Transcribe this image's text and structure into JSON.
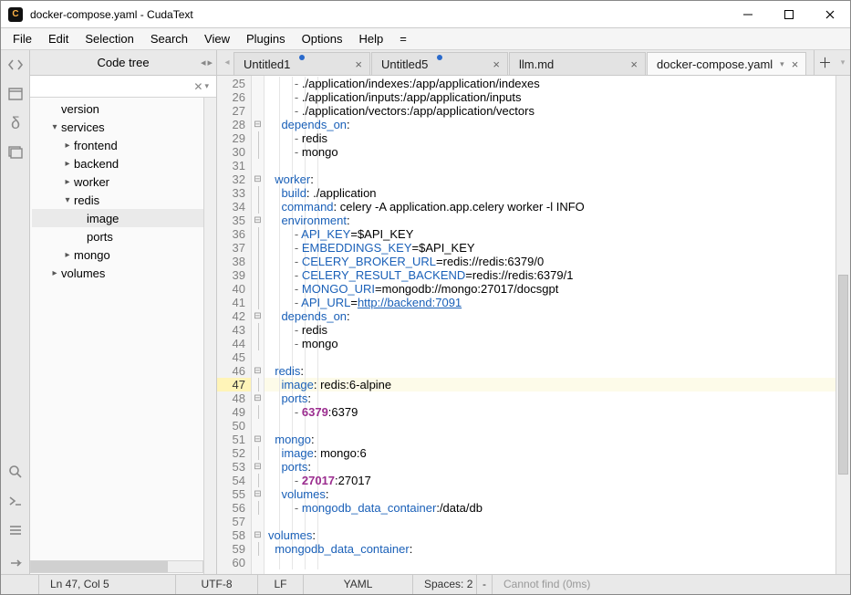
{
  "title": "docker-compose.yaml - CudaText",
  "menu": [
    "File",
    "Edit",
    "Selection",
    "Search",
    "View",
    "Plugins",
    "Options",
    "Help",
    "="
  ],
  "sidebar": {
    "title": "Code tree",
    "tree": [
      {
        "label": "version",
        "lvl": 1,
        "tw": ""
      },
      {
        "label": "services",
        "lvl": 1,
        "tw": "▾"
      },
      {
        "label": "frontend",
        "lvl": 2,
        "tw": "▸"
      },
      {
        "label": "backend",
        "lvl": 2,
        "tw": "▸"
      },
      {
        "label": "worker",
        "lvl": 2,
        "tw": "▸"
      },
      {
        "label": "redis",
        "lvl": 2,
        "tw": "▾"
      },
      {
        "label": "image",
        "lvl": 3,
        "tw": "",
        "selected": true
      },
      {
        "label": "ports",
        "lvl": 3,
        "tw": ""
      },
      {
        "label": "mongo",
        "lvl": 2,
        "tw": "▸"
      },
      {
        "label": "volumes",
        "lvl": 1,
        "tw": "▸"
      }
    ]
  },
  "tabs": [
    {
      "label": "Untitled1",
      "modified": true,
      "active": false
    },
    {
      "label": "Untitled5",
      "modified": true,
      "active": false
    },
    {
      "label": "llm.md",
      "modified": false,
      "active": false
    },
    {
      "label": "docker-compose.yaml",
      "modified": false,
      "active": true,
      "chev": true
    }
  ],
  "lines_start": 25,
  "current_line": 47,
  "code_lines": [
    {
      "n": 25,
      "fold": "",
      "html": "        <span class='tok-punct'>-</span> ./application/indexes:/app/application/indexes"
    },
    {
      "n": 26,
      "fold": "",
      "html": "        <span class='tok-punct'>-</span> ./application/inputs:/app/application/inputs"
    },
    {
      "n": 27,
      "fold": "",
      "html": "        <span class='tok-punct'>-</span> ./application/vectors:/app/application/vectors"
    },
    {
      "n": 28,
      "fold": "⊟",
      "html": "    <span class='tok-key'>depends_on</span>:"
    },
    {
      "n": 29,
      "fold": "│",
      "html": "        <span class='tok-punct'>-</span> redis"
    },
    {
      "n": 30,
      "fold": "│",
      "html": "        <span class='tok-punct'>-</span> mongo"
    },
    {
      "n": 31,
      "fold": "",
      "html": ""
    },
    {
      "n": 32,
      "fold": "⊟",
      "html": "  <span class='tok-key'>worker</span>:"
    },
    {
      "n": 33,
      "fold": "│",
      "html": "    <span class='tok-key'>build</span>: ./application"
    },
    {
      "n": 34,
      "fold": "│",
      "html": "    <span class='tok-key'>command</span>: celery -A application.app.celery worker -l INFO"
    },
    {
      "n": 35,
      "fold": "⊟",
      "html": "    <span class='tok-key'>environment</span>:"
    },
    {
      "n": 36,
      "fold": "│",
      "html": "        <span class='tok-punct'>-</span> <span class='tok-key'>API_KEY</span>=$API_KEY"
    },
    {
      "n": 37,
      "fold": "│",
      "html": "        <span class='tok-punct'>-</span> <span class='tok-key'>EMBEDDINGS_KEY</span>=$API_KEY"
    },
    {
      "n": 38,
      "fold": "│",
      "html": "        <span class='tok-punct'>-</span> <span class='tok-key'>CELERY_BROKER_URL</span>=redis://redis:6379/0"
    },
    {
      "n": 39,
      "fold": "│",
      "html": "        <span class='tok-punct'>-</span> <span class='tok-key'>CELERY_RESULT_BACKEND</span>=redis://redis:6379/1"
    },
    {
      "n": 40,
      "fold": "│",
      "html": "        <span class='tok-punct'>-</span> <span class='tok-key'>MONGO_URI</span>=mongodb://mongo:27017/docsgpt"
    },
    {
      "n": 41,
      "fold": "│",
      "html": "        <span class='tok-punct'>-</span> <span class='tok-key'>API_URL</span>=<span class='tok-link'>http://backend:7091</span>"
    },
    {
      "n": 42,
      "fold": "⊟",
      "html": "    <span class='tok-key'>depends_on</span>:"
    },
    {
      "n": 43,
      "fold": "│",
      "html": "        <span class='tok-punct'>-</span> redis"
    },
    {
      "n": 44,
      "fold": "│",
      "html": "        <span class='tok-punct'>-</span> mongo"
    },
    {
      "n": 45,
      "fold": "",
      "html": ""
    },
    {
      "n": 46,
      "fold": "⊟",
      "html": "  <span class='tok-key'>redis</span>:"
    },
    {
      "n": 47,
      "fold": "│",
      "html": "    <span class='tok-key'>image</span>: redis:6-alpine",
      "current": true
    },
    {
      "n": 48,
      "fold": "⊟",
      "html": "    <span class='tok-key'>ports</span>:"
    },
    {
      "n": 49,
      "fold": "│",
      "html": "        <span class='tok-punct'>-</span> <span class='tok-num'>6379</span>:6379"
    },
    {
      "n": 50,
      "fold": "",
      "html": ""
    },
    {
      "n": 51,
      "fold": "⊟",
      "html": "  <span class='tok-key'>mongo</span>:"
    },
    {
      "n": 52,
      "fold": "│",
      "html": "    <span class='tok-key'>image</span>: mongo:6"
    },
    {
      "n": 53,
      "fold": "⊟",
      "html": "    <span class='tok-key'>ports</span>:"
    },
    {
      "n": 54,
      "fold": "│",
      "html": "        <span class='tok-punct'>-</span> <span class='tok-num'>27017</span>:27017"
    },
    {
      "n": 55,
      "fold": "⊟",
      "html": "    <span class='tok-key'>volumes</span>:"
    },
    {
      "n": 56,
      "fold": "│",
      "html": "        <span class='tok-punct'>-</span> <span class='tok-key'>mongodb_data_container</span>:/data/db"
    },
    {
      "n": 57,
      "fold": "",
      "html": ""
    },
    {
      "n": 58,
      "fold": "⊟",
      "html": "<span class='tok-key'>volumes</span>:"
    },
    {
      "n": 59,
      "fold": "│",
      "html": "  <span class='tok-key'>mongodb_data_container</span>:"
    },
    {
      "n": 60,
      "fold": "",
      "html": ""
    }
  ],
  "status": {
    "pos": "Ln 47, Col 5",
    "enc": "UTF-8",
    "le": "LF",
    "lang": "YAML",
    "spaces": "Spaces: 2",
    "sep": "-",
    "msg": "Cannot find (0ms)"
  }
}
